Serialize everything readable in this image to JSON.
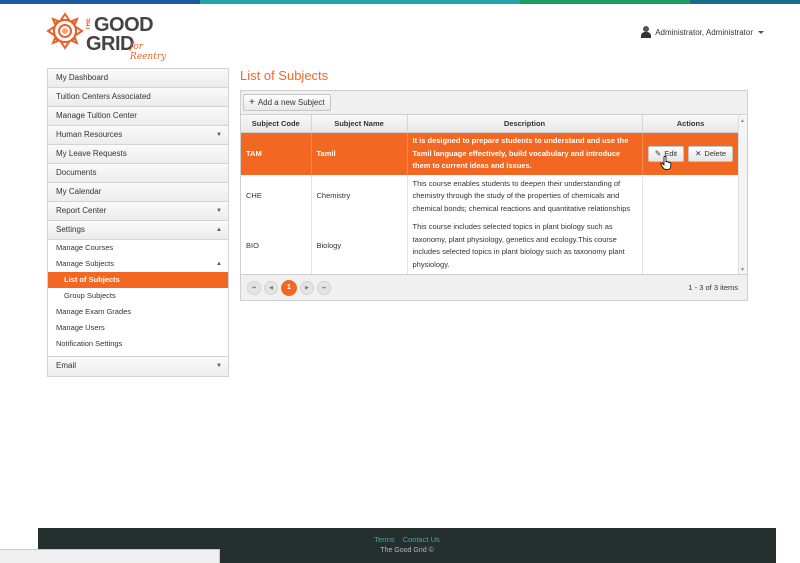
{
  "colors": {
    "accent": "#f26722",
    "topbar": [
      "#1b5aa0",
      "#22a3a8",
      "#1a9e5a",
      "#1a6c8c"
    ],
    "footer_bg": "#25302e",
    "footer_link": "#2bb5a5"
  },
  "brand": {
    "line1": "GOOD",
    "line1_prefix": "THE",
    "line2": "GRID",
    "tagline": "for Reentry"
  },
  "user": {
    "name": "Administrator, Administrator",
    "icon": "user-icon"
  },
  "sidebar": {
    "items": [
      {
        "label": "My Dashboard"
      },
      {
        "label": "Tuition Centers Associated"
      },
      {
        "label": "Manage Tuition Center"
      },
      {
        "label": "Human Resources",
        "arrow": "▼"
      },
      {
        "label": "My Leave Requests"
      },
      {
        "label": "Documents"
      },
      {
        "label": "My Calendar"
      },
      {
        "label": "Report Center",
        "arrow": "▼"
      },
      {
        "label": "Settings",
        "arrow": "▲"
      }
    ],
    "settings_sub": [
      {
        "label": "Manage Courses"
      },
      {
        "label": "Manage Subjects",
        "arrow": "▲"
      },
      {
        "label": "List of Subjects"
      },
      {
        "label": "Group Subjects"
      },
      {
        "label": "Manage Exam Grades"
      },
      {
        "label": "Manage Users"
      },
      {
        "label": "Notification Settings"
      }
    ],
    "email": {
      "label": "Email",
      "arrow": "▼"
    }
  },
  "main": {
    "title": "List of Subjects",
    "add_button": "Add a new Subject",
    "columns": [
      "Subject Code",
      "Subject Name",
      "Description",
      "Actions"
    ],
    "rows": [
      {
        "code": "TAM",
        "name": "Tamil",
        "description": "It is designed to prepare students to understand and use the Tamil language effectively, build vocabulary and introduce them to current ideas and issues.",
        "selected": true
      },
      {
        "code": "CHE",
        "name": "Chemistry",
        "description": "This course enables students to deepen their understanding of chemistry through the study of the properties of chemicals and chemical bonds; chemical reactions and quantitative relationships",
        "selected": false
      },
      {
        "code": "BIO",
        "name": "Biology",
        "description": "This course includes selected topics in plant biology such as taxonomy, plant physiology, genetics and ecology.This course includes selected topics in plant biology such as taxonomy plant physiology.",
        "selected": false
      }
    ],
    "edit_label": "Edit",
    "delete_label": "Delete",
    "pager": {
      "first": "⏮",
      "prev": "◀",
      "current": "1",
      "next": "▶",
      "last": "⏭",
      "info": "1 - 3 of 3 items"
    }
  },
  "footer": {
    "terms": "Terms",
    "contact": "Contact Us",
    "copyright": "The Good Grid ©"
  }
}
